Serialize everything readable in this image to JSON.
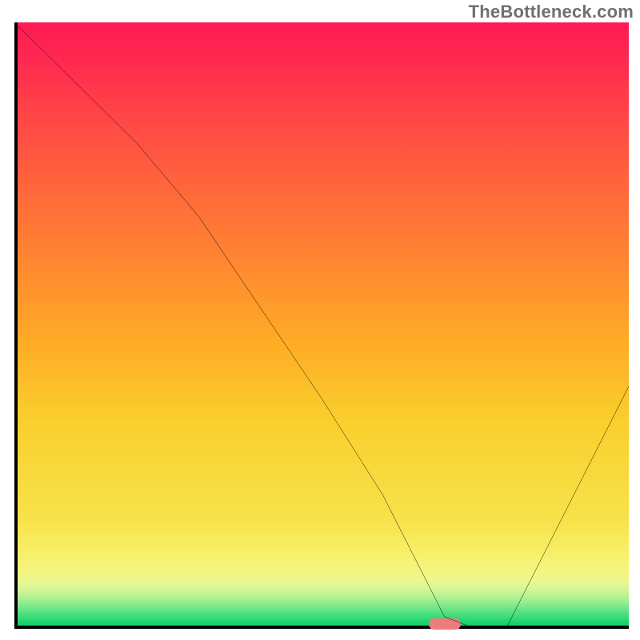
{
  "watermark": "TheBottleneck.com",
  "chart_data": {
    "type": "line",
    "title": "",
    "xlabel": "",
    "ylabel": "",
    "xlim": [
      0,
      100
    ],
    "ylim": [
      0,
      100
    ],
    "series": [
      {
        "name": "bottleneck-curve",
        "x": [
          0,
          10,
          20,
          30,
          40,
          50,
          60,
          65,
          70,
          75,
          80,
          90,
          100
        ],
        "values": [
          100,
          90,
          80,
          68,
          53,
          38,
          22,
          12,
          2,
          0,
          0,
          20,
          40
        ]
      }
    ],
    "marker": {
      "x_pct": 70,
      "y_pct": 0,
      "color": "#eb7d7d"
    },
    "background": {
      "type": "vertical-gradient",
      "stops": [
        {
          "pct": 0,
          "color": "#ff1a55"
        },
        {
          "pct": 35,
          "color": "#ff6a3a"
        },
        {
          "pct": 65,
          "color": "#ffad26"
        },
        {
          "pct": 82,
          "color": "#f7e24a"
        },
        {
          "pct": 92,
          "color": "#b7f292"
        },
        {
          "pct": 100,
          "color": "#0ace66"
        }
      ]
    }
  }
}
